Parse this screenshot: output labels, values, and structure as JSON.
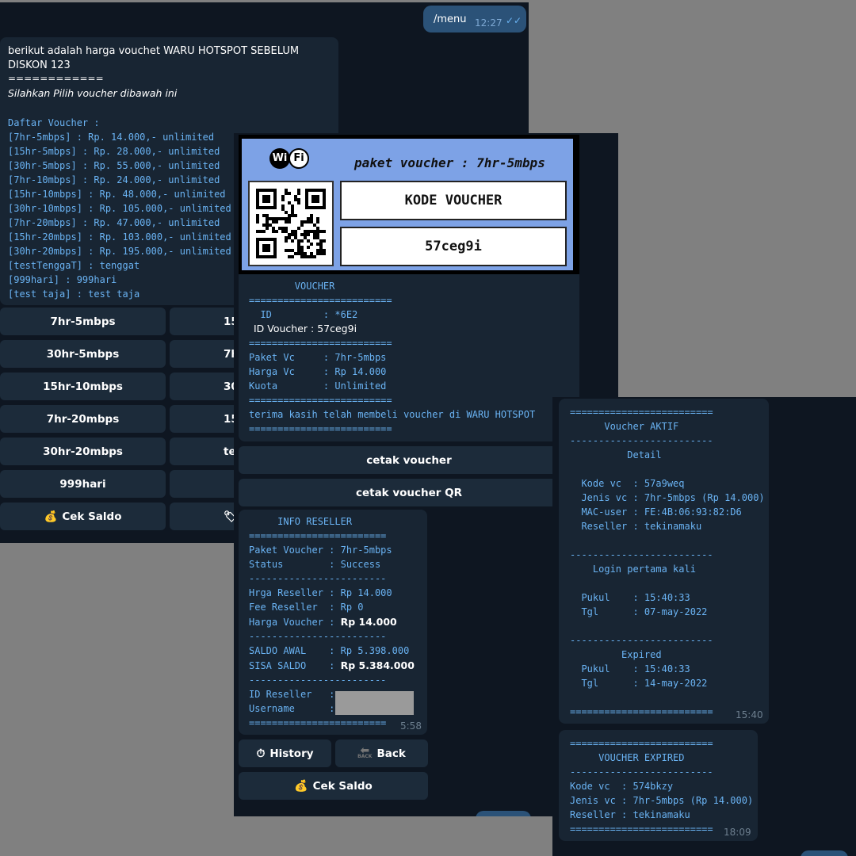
{
  "panel1": {
    "user_msg": {
      "text": "/menu",
      "time": "12:27"
    },
    "bot_msg": {
      "header": "berikut adalah harga vouchet WARU HOTSPOT SEBELUM DISKON 123",
      "separator": "============",
      "subtitle": "Silahkan Pilih voucher dibawah ini",
      "list_title": "Daftar Voucher :",
      "list": [
        "[7hr-5mbps] : Rp. 14.000,- unlimited",
        "[15hr-5mbps] : Rp. 28.000,- unlimited",
        "[30hr-5mbps] : Rp. 55.000,- unlimited",
        "[7hr-10mbps] : Rp. 24.000,- unlimited",
        "[15hr-10mbps] : Rp. 48.000,- unlimited",
        "[30hr-10mbps] : Rp. 105.000,- unlimited",
        "[7hr-20mbps] : Rp. 47.000,- unlimited",
        "[15hr-20mbps] : Rp. 103.000,- unlimited",
        "[30hr-20mbps] : Rp. 195.000,- unlimited",
        "[testTenggaT] : tenggat",
        "[999hari] : 999hari",
        "[test taja] : test taja"
      ]
    },
    "buttons_left": [
      "7hr-5mbps",
      "30hr-5mbps",
      "15hr-10mbps",
      "7hr-20mbps",
      "30hr-20mbps",
      "999hari",
      "Cek Saldo"
    ],
    "buttons_right": [
      "15",
      "7h",
      "30",
      "15",
      "te",
      "",
      ""
    ]
  },
  "panel2": {
    "card": {
      "logo_left": "Wi",
      "logo_right": "Fi",
      "title": "paket voucher : 7hr-5mbps",
      "label": "KODE VOUCHER",
      "code": "57ceg9i"
    },
    "info": {
      "heading": "        VOUCHER",
      "sep": "=========================",
      "id_line": "  ID         : *6E2",
      "id_voucher": "ID Voucher : 57ceg9i",
      "paket": "Paket Vc     : 7hr-5mbps",
      "harga": "Harga Vc     : Rp 14.000",
      "kuota": "Kuota        : Unlimited",
      "thanks": "terima kasih telah membeli voucher di WARU HOTSPOT"
    },
    "btn_cetak": "cetak voucher",
    "btn_cetak_qr": "cetak voucher QR",
    "reseller": {
      "heading": "     INFO RESELLER",
      "sep_eq": "========================",
      "sep_dash": "------------------------",
      "paket": "Paket Voucher : 7hr-5mbps",
      "status": "Status        : Success",
      "hrga_reseller": "Hrga Reseller : Rp 14.000",
      "fee": "Fee Reseller  : Rp 0",
      "harga_voucher_label": "Harga Voucher : ",
      "harga_voucher_value": "Rp 14.000",
      "saldo_awal": "SALDO AWAL    : Rp 5.398.000",
      "sisa_label": "SISA SALDO    : ",
      "sisa_value": "Rp 5.384.000",
      "id_reseller": "ID Reseller   :",
      "username": "Username      :",
      "time": "5:58"
    },
    "btn_history": "History",
    "btn_back": "Back",
    "btn_back_icon_text": "BACK",
    "btn_cek_saldo": "Cek Saldo"
  },
  "panel3": {
    "msg1": {
      "lines": [
        "=========================",
        "      Voucher AKTIF",
        "-------------------------",
        "          Detail",
        "",
        "  Kode vc  : 57a9weq",
        "  Jenis vc : 7hr-5mbps (Rp 14.000)",
        "  MAC-user : FE:4B:06:93:82:D6",
        "  Reseller : tekinamaku",
        "",
        "-------------------------",
        "    Login pertama kali",
        "",
        "  Pukul    : 15:40:33",
        "  Tgl      : 07-may-2022",
        "",
        "-------------------------",
        "         Expired",
        "  Pukul    : 15:40:33",
        "  Tgl      : 14-may-2022",
        "",
        "========================="
      ],
      "time": "15:40"
    },
    "msg2": {
      "lines": [
        "=========================",
        "     VOUCHER EXPIRED",
        "-------------------------",
        "Kode vc  : 574bkzy",
        "Jenis vc : 7hr-5mbps (Rp 14.000)",
        "Reseller : tekinamaku",
        "========================="
      ],
      "time": "18:09"
    }
  }
}
